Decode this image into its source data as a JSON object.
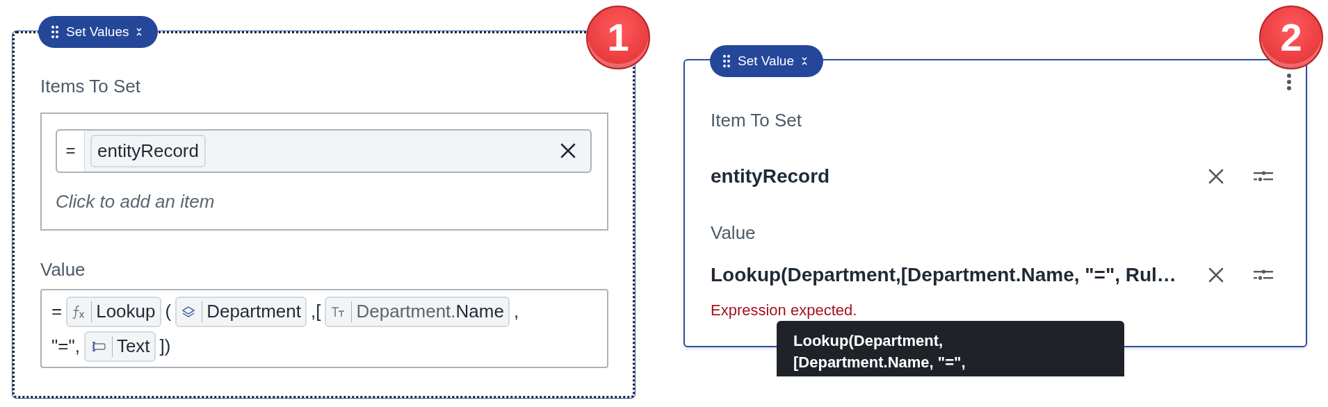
{
  "panels": [
    {
      "kind": "editor",
      "selected": true,
      "badge": "1",
      "pill": {
        "label": "Set Values"
      },
      "items_label": "Items To Set",
      "items": [
        {
          "operator": "=",
          "chip": "entityRecord"
        }
      ],
      "add_placeholder": "Click to add an item",
      "value_label": "Value",
      "value_lines": [
        [
          {
            "kind": "text",
            "text": "="
          },
          {
            "kind": "function",
            "text": "Lookup"
          },
          {
            "kind": "text",
            "text": "("
          },
          {
            "kind": "entity",
            "text": "Department"
          },
          {
            "kind": "text",
            "text": ",["
          },
          {
            "kind": "field",
            "path": "Department.",
            "text": "Name"
          },
          {
            "kind": "text",
            "text": ","
          }
        ],
        [
          {
            "kind": "text",
            "text": "\"=\","
          },
          {
            "kind": "input",
            "text": "Text"
          },
          {
            "kind": "text",
            "text": "])"
          }
        ]
      ]
    },
    {
      "kind": "summary",
      "selected": false,
      "badge": "2",
      "pill": {
        "label": "Set Value"
      },
      "item_label": "Item To Set",
      "item": "entityRecord",
      "value_label": "Value",
      "value": "Lookup(Department,[Department.Name, \"=\", Rul…",
      "error": "Expression expected.",
      "tooltip": [
        "Lookup(Department,",
        "[Department.Name, \"=\","
      ]
    }
  ]
}
